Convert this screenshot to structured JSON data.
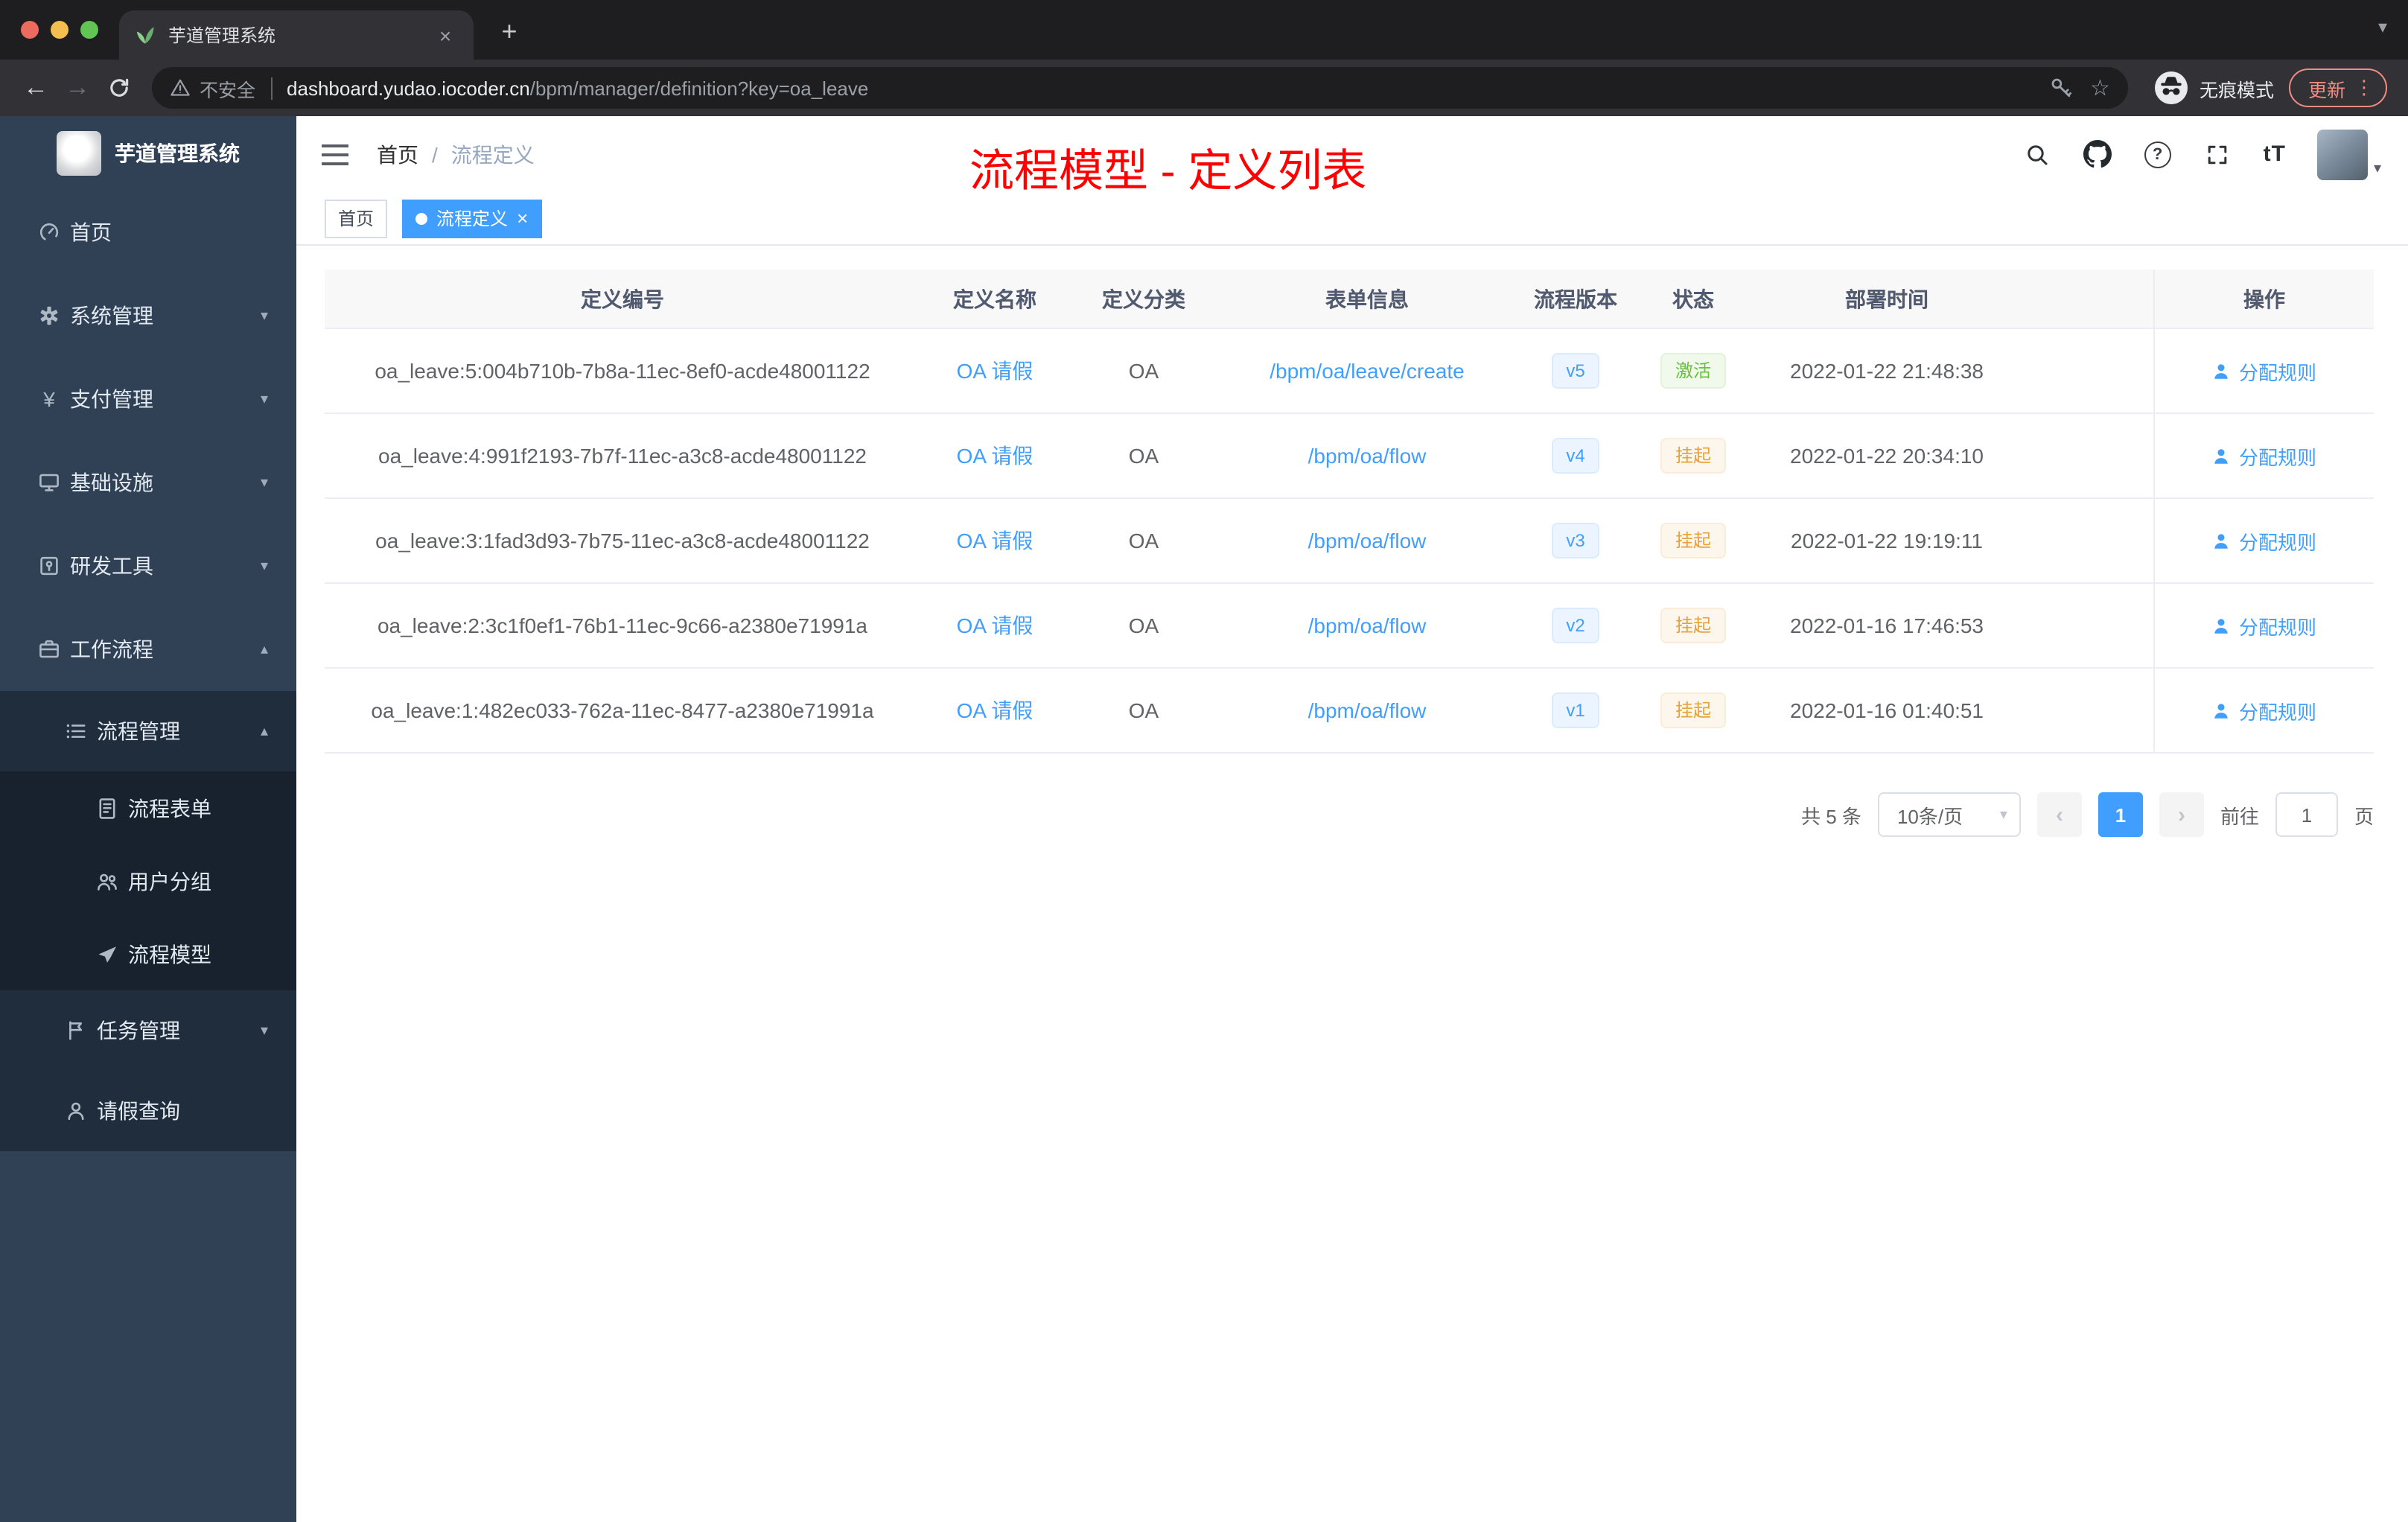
{
  "icons": {
    "close": "×",
    "plus": "+",
    "dots": "⋮",
    "star": "☆",
    "back": "←",
    "forward": "→",
    "caret_down": "▾",
    "caret_up": "▴",
    "prev": "‹",
    "next": "›",
    "question": "?",
    "yen": "¥",
    "font_size": "tT"
  },
  "browser": {
    "tab_title": "芋道管理系统",
    "security_label": "不安全",
    "url_domain": "dashboard.yudao.iocoder.cn",
    "url_path": "/bpm/manager/definition?key=oa_leave",
    "incognito_label": "无痕模式",
    "update_label": "更新"
  },
  "sidebar": {
    "app_title": "芋道管理系统",
    "items": [
      {
        "label": "首页"
      },
      {
        "label": "系统管理"
      },
      {
        "label": "支付管理"
      },
      {
        "label": "基础设施"
      },
      {
        "label": "研发工具"
      },
      {
        "label": "工作流程"
      },
      {
        "label": "流程管理"
      },
      {
        "label": "流程表单"
      },
      {
        "label": "用户分组"
      },
      {
        "label": "流程模型"
      },
      {
        "label": "任务管理"
      },
      {
        "label": "请假查询"
      }
    ]
  },
  "navbar": {
    "breadcrumb": [
      "首页",
      "流程定义"
    ],
    "separator": "/",
    "annotation": "流程模型 - 定义列表"
  },
  "tags": {
    "items": [
      {
        "label": "首页",
        "active": false
      },
      {
        "label": "流程定义",
        "active": true
      }
    ]
  },
  "table": {
    "columns": [
      "定义编号",
      "定义名称",
      "定义分类",
      "表单信息",
      "流程版本",
      "状态",
      "部署时间",
      "操作"
    ],
    "rows": [
      {
        "id": "oa_leave:5:004b710b-7b8a-11ec-8ef0-acde48001122",
        "name": "OA 请假",
        "category": "OA",
        "form": "/bpm/oa/leave/create",
        "version": "v5",
        "status": "激活",
        "status_type": "success",
        "deployed_at": "2022-01-22 21:48:38",
        "action": "分配规则"
      },
      {
        "id": "oa_leave:4:991f2193-7b7f-11ec-a3c8-acde48001122",
        "name": "OA 请假",
        "category": "OA",
        "form": "/bpm/oa/flow",
        "version": "v4",
        "status": "挂起",
        "status_type": "warning",
        "deployed_at": "2022-01-22 20:34:10",
        "action": "分配规则"
      },
      {
        "id": "oa_leave:3:1fad3d93-7b75-11ec-a3c8-acde48001122",
        "name": "OA 请假",
        "category": "OA",
        "form": "/bpm/oa/flow",
        "version": "v3",
        "status": "挂起",
        "status_type": "warning",
        "deployed_at": "2022-01-22 19:19:11",
        "action": "分配规则"
      },
      {
        "id": "oa_leave:2:3c1f0ef1-76b1-11ec-9c66-a2380e71991a",
        "name": "OA 请假",
        "category": "OA",
        "form": "/bpm/oa/flow",
        "version": "v2",
        "status": "挂起",
        "status_type": "warning",
        "deployed_at": "2022-01-16 17:46:53",
        "action": "分配规则"
      },
      {
        "id": "oa_leave:1:482ec033-762a-11ec-8477-a2380e71991a",
        "name": "OA 请假",
        "category": "OA",
        "form": "/bpm/oa/flow",
        "version": "v1",
        "status": "挂起",
        "status_type": "warning",
        "deployed_at": "2022-01-16 01:40:51",
        "action": "分配规则"
      }
    ]
  },
  "pagination": {
    "total": "共 5 条",
    "page_size": "10条/页",
    "page": "1",
    "goto_label": "前往",
    "goto_value": "1",
    "goto_suffix": "页"
  },
  "colors": {
    "accent": "#409eff",
    "annotation_red": "#ff0000",
    "sidebar_bg": "#304156",
    "submenu_bg": "#1f2d3d",
    "status_active_green": "#67c23a",
    "status_suspended_orange": "#e6a23c"
  }
}
